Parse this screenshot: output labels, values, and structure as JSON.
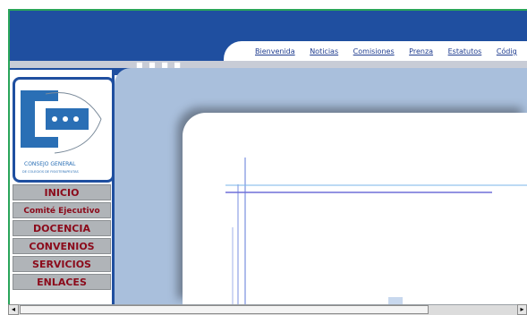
{
  "nav": {
    "links": [
      "Bienvenida",
      "Noticias",
      "Comisiones",
      "Prenza",
      "Estatutos",
      "Códig"
    ]
  },
  "logo": {
    "arc_text_left": "CONSEJO GENERAL",
    "arc_text_right": "DE COLEGIOS DE FISIOTERAPEUTAS",
    "bottom_line1": "CONSEJO GENERAL",
    "bottom_line2": "DE COLEGIOS DE FISIOTERAPEUTAS"
  },
  "menu": {
    "items": [
      "INICIO",
      "Comité Ejecutivo",
      "DOCENCIA",
      "CONVENIOS",
      "SERVICIOS",
      "ENLACES"
    ]
  },
  "colors": {
    "header_blue": "#1f4fa0",
    "content_blue": "#a9bfdc",
    "menu_text": "#8b0a1a",
    "menu_bg": "#b0b4b8"
  },
  "scrollbar": {
    "left_arrow": "◂",
    "right_arrow": "▸"
  }
}
